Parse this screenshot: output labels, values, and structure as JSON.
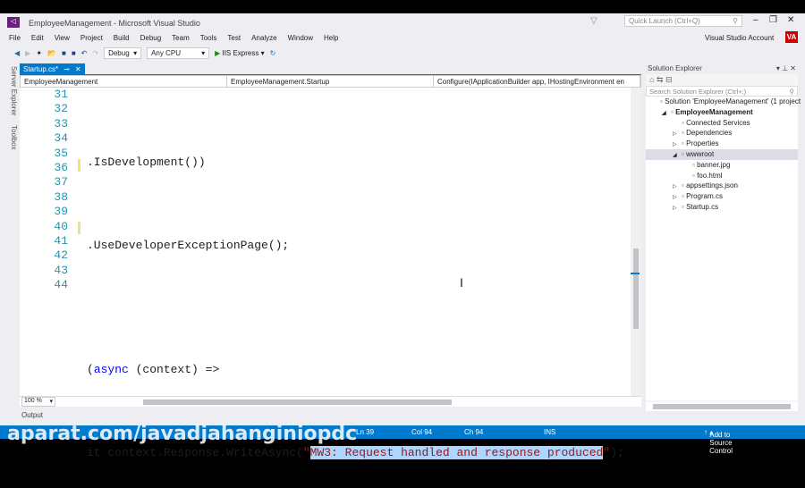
{
  "window": {
    "title": "EmployeeManagement - Microsoft Visual Studio",
    "quick_launch": "Quick Launch (Ctrl+Q)",
    "account": "Visual Studio Account",
    "avatar": "VA"
  },
  "menu": [
    "File",
    "Edit",
    "View",
    "Project",
    "Build",
    "Debug",
    "Team",
    "Tools",
    "Test",
    "Analyze",
    "Window",
    "Help"
  ],
  "toolbar": {
    "config": "Debug",
    "platform": "Any CPU",
    "run": "IIS Express"
  },
  "side_tabs": [
    "Server Explorer",
    "Toolbox"
  ],
  "tab": {
    "label": "Startup.cs*"
  },
  "nav": {
    "project": "EmployeeManagement",
    "class": "EmployeeManagement.Startup",
    "member": "Configure(IApplicationBuilder app, IHostingEnvironment en"
  },
  "editor": {
    "line_numbers": [
      "31",
      "32",
      "33",
      "34",
      "35",
      "36",
      "37",
      "38",
      "39",
      "40",
      "41",
      "42",
      "43",
      "44"
    ],
    "lines": [
      "",
      ".IsDevelopment())",
      "",
      ".UseDeveloperExceptionPage();",
      "",
      "",
      "(async (context) =>",
      "",
      "",
      "",
      "",
      "",
      "",
      ""
    ],
    "line39": {
      "pre": "it context.Response.WriteAsync(",
      "q1": "\"",
      "selected": "MW3: Request handled and response produced",
      "q2": "\"",
      "post": ");"
    },
    "async_kw": "async",
    "zoom": "100 %"
  },
  "solution_explorer": {
    "title": "Solution Explorer",
    "search_placeholder": "Search Solution Explorer (Ctrl+;)",
    "items": [
      {
        "label": "Solution 'EmployeeManagement' (1 project",
        "indent": 0,
        "expander": ""
      },
      {
        "label": "EmployeeManagement",
        "indent": 1,
        "expander": "◢"
      },
      {
        "label": "Connected Services",
        "indent": 2,
        "expander": ""
      },
      {
        "label": "Dependencies",
        "indent": 2,
        "expander": "▷"
      },
      {
        "label": "Properties",
        "indent": 2,
        "expander": "▷"
      },
      {
        "label": "wwwroot",
        "indent": 2,
        "expander": "◢"
      },
      {
        "label": "banner.jpg",
        "indent": 3,
        "expander": ""
      },
      {
        "label": "foo.html",
        "indent": 3,
        "expander": ""
      },
      {
        "label": "appsettings.json",
        "indent": 2,
        "expander": "▷"
      },
      {
        "label": "Program.cs",
        "indent": 2,
        "expander": "▷"
      },
      {
        "label": "Startup.cs",
        "indent": 2,
        "expander": "▷"
      }
    ]
  },
  "output": {
    "label": "Output"
  },
  "status": {
    "ln": "Ln 39",
    "col": "Col 94",
    "ch": "Ch 94",
    "mode": "INS",
    "source_control": "Add to Source Control"
  },
  "watermark": "aparat.com/javadjahanginiopdc",
  "colors": {
    "accent": "#007acc",
    "selection": "#add6ff"
  }
}
